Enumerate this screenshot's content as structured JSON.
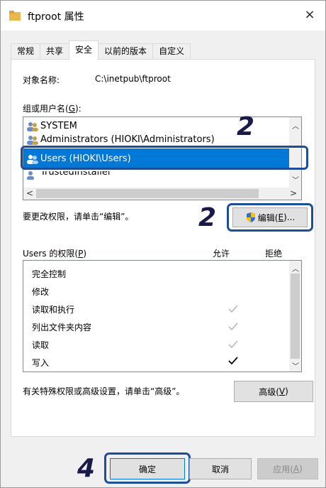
{
  "window": {
    "title": "ftproot 属性",
    "close": "×"
  },
  "tabs": [
    "常规",
    "共享",
    "安全",
    "以前的版本",
    "自定义"
  ],
  "object_name": {
    "label": "对象名称:",
    "value": "C:\\inetpub\\ftproot"
  },
  "groups": {
    "label_prefix": "组或用户名(",
    "label_key": "G",
    "label_suffix": "):",
    "items": [
      "SYSTEM",
      "Administrators (HIOKI\\Administrators)",
      "Users (HIOKI\\Users)",
      "TrustedInstaller"
    ],
    "selected": "Users (HIOKI\\Users)"
  },
  "change_hint": "要更改权限，请单击“编辑”。",
  "edit_button": {
    "label_prefix": "编辑(",
    "key": "E",
    "label_suffix": ")..."
  },
  "permissions": {
    "header_prefix": "Users 的权限(",
    "header_key": "P",
    "header_suffix": ")",
    "allow": "允许",
    "deny": "拒绝",
    "rows": [
      {
        "name": "完全控制",
        "allow": "none"
      },
      {
        "name": "修改",
        "allow": "none"
      },
      {
        "name": "读取和执行",
        "allow": "grey"
      },
      {
        "name": "列出文件夹内容",
        "allow": "grey"
      },
      {
        "name": "读取",
        "allow": "grey"
      },
      {
        "name": "写入",
        "allow": "black"
      }
    ]
  },
  "advanced_hint": "有关特殊权限或高级设置，请单击“高级”。",
  "advanced_button": {
    "label_prefix": "高级(",
    "key": "V",
    "label_suffix": ")"
  },
  "footer": {
    "ok": "确定",
    "cancel": "取消",
    "apply_prefix": "应用(",
    "apply_key": "A",
    "apply_suffix": ")"
  },
  "steps": {
    "list": "2",
    "edit": "2",
    "ok": "4"
  },
  "colors": {
    "selection": "#0078d7",
    "outline": "#1f4e99",
    "step": "#1a1a4a"
  }
}
